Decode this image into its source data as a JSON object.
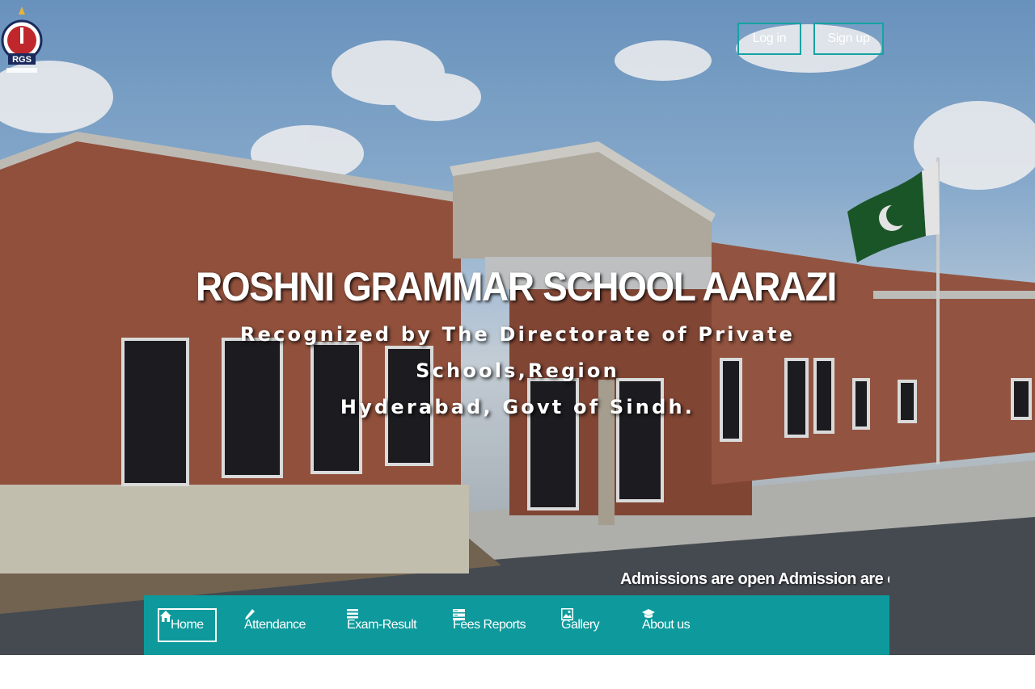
{
  "header": {
    "logo_text": "RGS",
    "login_label": "Log in",
    "signup_label": "Sign up"
  },
  "hero": {
    "title": "ROSHNI GRAMMAR SCHOOL AARAZI",
    "subtitle_line1": "Recognized by The Directorate of Private Schools,Region",
    "subtitle_line2": "Hyderabad, Govt of Sindh."
  },
  "ticker": {
    "text": "Admissions are open Admission are open Admissions are open"
  },
  "nav": {
    "items": [
      {
        "label": "Home",
        "icon": "home-icon"
      },
      {
        "label": "Attendance",
        "icon": "pencil-icon"
      },
      {
        "label": "Exam-Result",
        "icon": "list-icon"
      },
      {
        "label": "Fees Reports",
        "icon": "report-icon"
      },
      {
        "label": "Gallery",
        "icon": "picture-icon"
      },
      {
        "label": "About us",
        "icon": "graduation-cap-icon"
      }
    ]
  },
  "colors": {
    "accent": "#0e9a9c",
    "button_border": "#15a3a3"
  }
}
